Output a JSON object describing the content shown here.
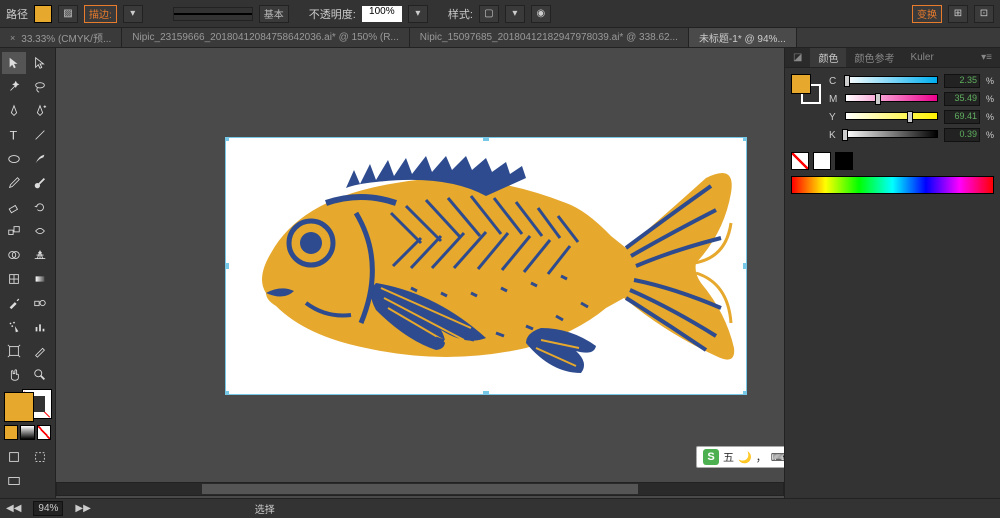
{
  "topbar": {
    "label": "路径",
    "stroke_label": "描边:",
    "stroke_style": "基本",
    "opacity_label": "不透明度:",
    "opacity_value": "100%",
    "style_label": "样式:",
    "transform_label": "变换"
  },
  "tabs": [
    {
      "label": "33.33% (CMYK/预...",
      "active": false
    },
    {
      "label": "Nipic_23159666_20180412084758642036.ai* @ 150% (R...",
      "active": false
    },
    {
      "label": "Nipic_15097685_20180412182947978039.ai* @ 338.62...",
      "active": false
    },
    {
      "label": "未标题-1* @ 94%...",
      "active": true
    }
  ],
  "color_panel": {
    "tabs": [
      "颜色",
      "颜色参考",
      "Kuler"
    ],
    "active_tab": "颜色",
    "cmyk": [
      {
        "ch": "C",
        "val": "2.35",
        "pct": 2.35
      },
      {
        "ch": "M",
        "val": "35.49",
        "pct": 35.49
      },
      {
        "ch": "Y",
        "val": "69.41",
        "pct": 69.41
      },
      {
        "ch": "K",
        "val": "0.39",
        "pct": 0.39
      }
    ]
  },
  "status": {
    "zoom": "94%",
    "mode": "选择"
  },
  "ime": {
    "logo": "S",
    "text": "五"
  },
  "colors": {
    "fill": "#e6a82d",
    "fish_body": "#e6a82d",
    "fish_detail": "#2d4b8e"
  },
  "icons": {
    "selection": "selection",
    "direct": "direct-selection",
    "wand": "magic-wand",
    "lasso": "lasso",
    "pen": "pen",
    "pen_add": "add-anchor",
    "type": "type",
    "line": "line-segment",
    "ellipse": "ellipse",
    "brush": "paintbrush",
    "pencil": "pencil",
    "blob": "blob-brush",
    "eraser": "eraser",
    "rotate": "rotate",
    "scale": "scale",
    "width": "width",
    "shape_builder": "shape-builder",
    "perspective": "perspective-grid",
    "mesh": "mesh",
    "gradient": "gradient",
    "eyedropper": "eyedropper",
    "blend": "blend",
    "spray": "symbol-sprayer",
    "graph": "column-graph",
    "artboard": "artboard",
    "slice": "slice",
    "hand": "hand",
    "zoom": "zoom"
  }
}
